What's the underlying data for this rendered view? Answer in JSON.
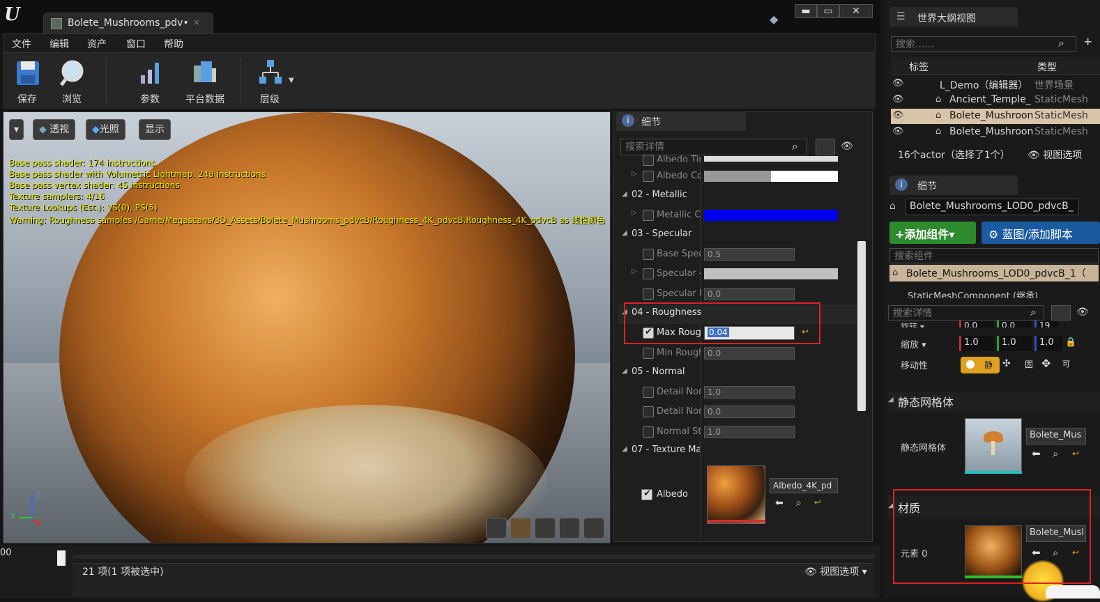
{
  "window": {
    "title_tab": "Bolete_Mushrooms_pdv•",
    "tab_close": "×",
    "minimize": "▬",
    "maximize": "▭",
    "close": "✕"
  },
  "menu": [
    "文件",
    "编辑",
    "资产",
    "窗口",
    "帮助"
  ],
  "toolbar": {
    "save": "保存",
    "browse": "浏览",
    "params": "参数",
    "platform": "平台数据",
    "hierarchy": "层级"
  },
  "viewport": {
    "buttons": {
      "dropdown": "▾",
      "perspective": "透视",
      "lighting": "光照",
      "show": "显示"
    },
    "stats": [
      "Base pass shader: 174 instructions",
      "Base pass shader with Volumetric Lightmap: 248 instructions",
      "Base pass vertex shader: 45 instructions",
      "Texture samplers: 4/16",
      "Texture Lookups (Est.): VS(0), PS(5)",
      "Warning: Roughness samples /Game/Megascans/3D_Assets/Bolete_Mushrooms_pdvcB/Roughness_4K_pdvcB.Roughness_4K_pdvcB as 线性颜色"
    ],
    "axis": {
      "z": "Z",
      "x": "X",
      "y": "Y"
    }
  },
  "details": {
    "tab": "细节",
    "search_placeholder": "搜索详情",
    "props": {
      "albedo_cut": "Albedo Tin",
      "albedo_color": "Albedo Cor",
      "metallic_cat": "02 - Metallic",
      "metallic_color": "Metallic Cc",
      "specular_cat": "03 - Specular",
      "base_spec": "Base Speci",
      "base_spec_val": "0.5",
      "specular": "Specular -",
      "specular_fr": "Specular Fr",
      "specular_fr_val": "0.0",
      "roughness_cat": "04 - Roughness",
      "max_rough": "Max Rough",
      "max_rough_val": "0.04",
      "min_rough": "Min Roughr",
      "min_rough_val": "0.0",
      "normal_cat": "05 - Normal",
      "detail_norm1": "Detail Norn",
      "detail_norm1_val": "1.0",
      "detail_norm2": "Detail Norn",
      "detail_norm2_val": "0.0",
      "normal_str": "Normal Stre",
      "normal_str_val": "1.0",
      "texmap_cat": "07 - Texture Maj",
      "albedo": "Albedo",
      "albedo_tex": "Albedo_4K_pd"
    }
  },
  "bottom": {
    "frame_num": "00",
    "items": "21 项(1 项被选中)",
    "view_options": "视图选项"
  },
  "outliner": {
    "tab": "世界大纲视图",
    "search_placeholder": "搜索......",
    "col_label": "标签",
    "col_type": "类型",
    "rows": [
      {
        "name": "L_Demo（编辑器）",
        "type": "世界场景"
      },
      {
        "name": "Ancient_Temple_",
        "type": "StaticMesh"
      },
      {
        "name": "Bolete_Mushroon",
        "type": "StaticMesh"
      },
      {
        "name": "Bolete_Mushroon",
        "type": "StaticMesh"
      }
    ],
    "footer": "16个actor（选择了1个）",
    "view_options": "视图选项"
  },
  "details2": {
    "tab": "细节",
    "actor_name": "Bolete_Mushrooms_LOD0_pdvcB_",
    "add_component": "+添加组件▾",
    "blueprint": "蓝图/添加脚本",
    "search_components": "搜索组件",
    "component_root": "Bolete_Mushrooms_LOD0_pdvcB_1（",
    "component_child": "StaticMeshComponent (继承)",
    "search_details": "搜索详情",
    "rotation_label": "旋转 ▾",
    "rotation_vals": [
      "0.0",
      "0.0",
      "19"
    ],
    "scale_label": "缩放 ▾",
    "scale_vals": [
      "1.0",
      "1.0",
      "1.0"
    ],
    "mobility_label": "移动性",
    "mobility_static": "静",
    "mobility_mid": "固",
    "mobility_move": "可",
    "static_mesh_section": "静态网格体",
    "static_mesh_label": "静态网格体",
    "static_mesh_asset": "Bolete_Mus",
    "material_section": "材质",
    "element0": "元素 0",
    "material_asset": "Bolete_Musl"
  }
}
